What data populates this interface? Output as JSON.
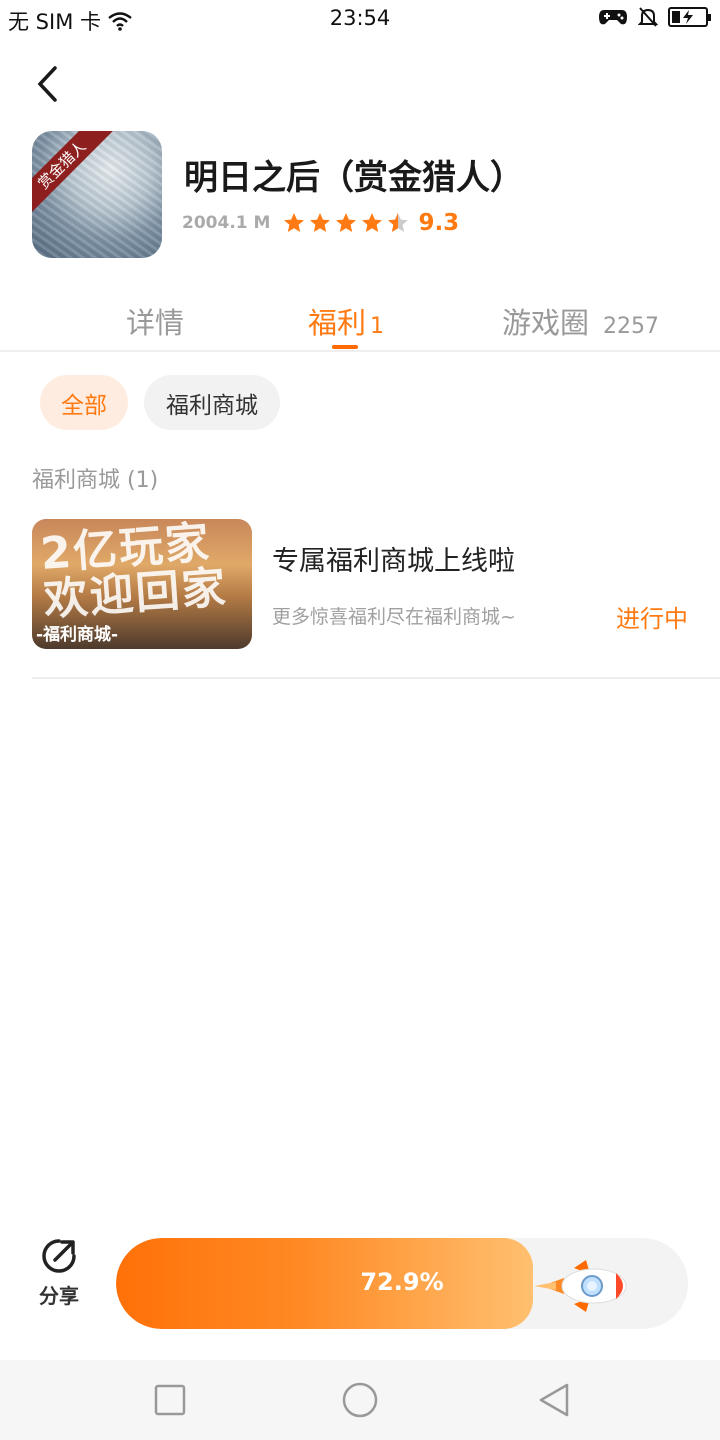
{
  "status_bar": {
    "carrier": "无 SIM 卡",
    "time": "23:54"
  },
  "game": {
    "icon_tag": "赏金猎人",
    "title": "明日之后（赏金猎人）",
    "size": "2004.1 M",
    "stars": 4.5,
    "rating": "9.3"
  },
  "tabs": [
    {
      "label": "详情",
      "count": ""
    },
    {
      "label": "福利",
      "count": "1"
    },
    {
      "label": "游戏圈",
      "count": "2257"
    }
  ],
  "filters": [
    {
      "label": "全部",
      "active": true
    },
    {
      "label": "福利商城",
      "active": false
    }
  ],
  "section": {
    "label": "福利商城 (1)"
  },
  "items": [
    {
      "thumb_text": "2亿玩家 欢迎回家",
      "thumb_tag": "-福利商城-",
      "title": "专属福利商城上线啦",
      "desc": "更多惊喜福利尽在福利商城~",
      "status": "进行中"
    }
  ],
  "bottom": {
    "share_label": "分享",
    "progress_text": "72.9%",
    "progress_value": 0.729
  },
  "colors": {
    "accent": "#ff7a12",
    "chip_active_bg": "#ffece0"
  },
  "icons": [
    "back-arrow-icon",
    "wifi-icon",
    "gamepad-icon",
    "mute-bell-icon",
    "battery-charging-icon",
    "star-icon",
    "share-icon",
    "rocket-icon",
    "square-icon",
    "circle-icon",
    "triangle-back-icon"
  ]
}
